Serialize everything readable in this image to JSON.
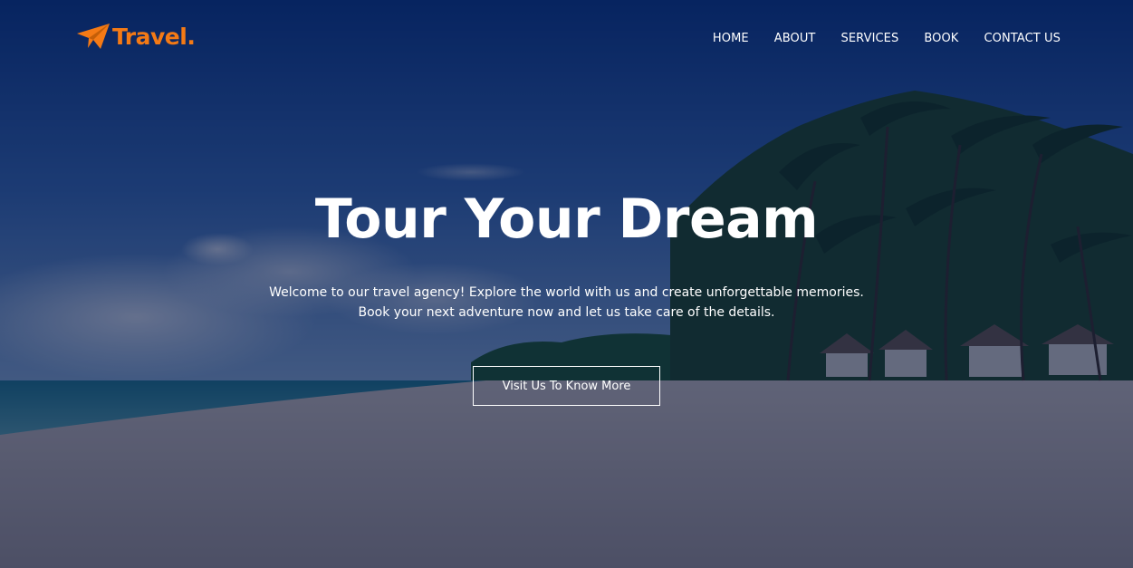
{
  "header": {
    "logo_text": "Travel.",
    "logo_icon": "paper-plane-icon",
    "brand_color": "#f47a15"
  },
  "nav": {
    "items": [
      {
        "label": "HOME"
      },
      {
        "label": "ABOUT"
      },
      {
        "label": "SERVICES"
      },
      {
        "label": "BOOK"
      },
      {
        "label": "CONTACT US"
      }
    ]
  },
  "hero": {
    "title": "Tour Your Dream",
    "description_line1": "Welcome to our travel agency! Explore the world with us and create unforgettable memories.",
    "description_line2": "Book your next adventure now and let us take care of the details.",
    "cta_label": "Visit Us To Know More",
    "background": "beach-palm-trees-image"
  }
}
